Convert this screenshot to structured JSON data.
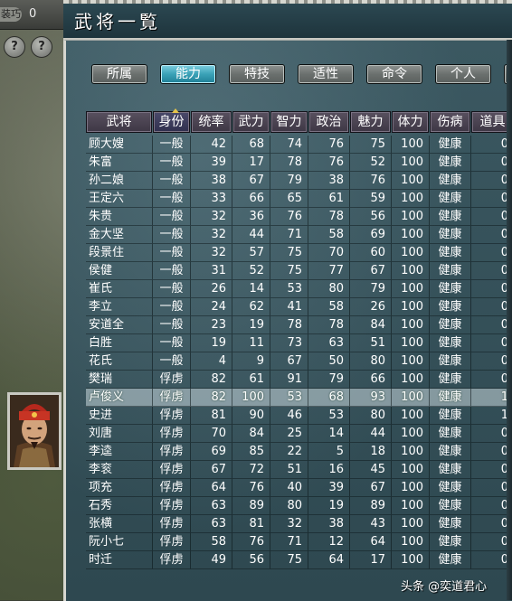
{
  "top_bar": {
    "pill": "装巧",
    "value": "0"
  },
  "side_buttons": [
    "?",
    "?"
  ],
  "window_title": "武将一覧",
  "tabs": [
    {
      "label": "所属",
      "active": false
    },
    {
      "label": "能力",
      "active": true
    },
    {
      "label": "特技",
      "active": false
    },
    {
      "label": "适性",
      "active": false
    },
    {
      "label": "命令",
      "active": false
    },
    {
      "label": "个人",
      "active": false
    }
  ],
  "columns": [
    "武将",
    "身份",
    "统率",
    "武力",
    "智力",
    "政治",
    "魅力",
    "体力",
    "伤病",
    "道具"
  ],
  "sorted_column": "身份",
  "rows": [
    [
      "顾大嫂",
      "一般",
      "42",
      "68",
      "74",
      "76",
      "75",
      "100",
      "健康",
      "0"
    ],
    [
      "朱富",
      "一般",
      "39",
      "17",
      "78",
      "76",
      "52",
      "100",
      "健康",
      "0"
    ],
    [
      "孙二娘",
      "一般",
      "38",
      "67",
      "79",
      "38",
      "76",
      "100",
      "健康",
      "0"
    ],
    [
      "王定六",
      "一般",
      "33",
      "66",
      "65",
      "61",
      "59",
      "100",
      "健康",
      "0"
    ],
    [
      "朱贵",
      "一般",
      "32",
      "36",
      "76",
      "78",
      "56",
      "100",
      "健康",
      "0"
    ],
    [
      "金大坚",
      "一般",
      "32",
      "44",
      "71",
      "58",
      "69",
      "100",
      "健康",
      "0"
    ],
    [
      "段景住",
      "一般",
      "32",
      "57",
      "75",
      "70",
      "60",
      "100",
      "健康",
      "0"
    ],
    [
      "侯健",
      "一般",
      "31",
      "52",
      "75",
      "77",
      "67",
      "100",
      "健康",
      "0"
    ],
    [
      "崔氏",
      "一般",
      "26",
      "14",
      "53",
      "80",
      "79",
      "100",
      "健康",
      "0"
    ],
    [
      "李立",
      "一般",
      "24",
      "62",
      "41",
      "58",
      "26",
      "100",
      "健康",
      "0"
    ],
    [
      "安道全",
      "一般",
      "23",
      "19",
      "78",
      "78",
      "84",
      "100",
      "健康",
      "0"
    ],
    [
      "白胜",
      "一般",
      "19",
      "11",
      "73",
      "63",
      "51",
      "100",
      "健康",
      "0"
    ],
    [
      "花氏",
      "一般",
      "4",
      "9",
      "67",
      "50",
      "80",
      "100",
      "健康",
      "0"
    ],
    [
      "樊瑞",
      "俘虏",
      "82",
      "61",
      "91",
      "79",
      "66",
      "100",
      "健康",
      "0"
    ],
    [
      "卢俊义",
      "俘虏",
      "82",
      "100",
      "53",
      "68",
      "93",
      "100",
      "健康",
      "1"
    ],
    [
      "史进",
      "俘虏",
      "81",
      "90",
      "46",
      "53",
      "80",
      "100",
      "健康",
      "1"
    ],
    [
      "刘唐",
      "俘虏",
      "70",
      "84",
      "25",
      "14",
      "44",
      "100",
      "健康",
      "0"
    ],
    [
      "李逵",
      "俘虏",
      "69",
      "85",
      "22",
      "5",
      "18",
      "100",
      "健康",
      "0"
    ],
    [
      "李衮",
      "俘虏",
      "67",
      "72",
      "51",
      "16",
      "45",
      "100",
      "健康",
      "0"
    ],
    [
      "项充",
      "俘虏",
      "64",
      "76",
      "40",
      "39",
      "67",
      "100",
      "健康",
      "0"
    ],
    [
      "石秀",
      "俘虏",
      "63",
      "89",
      "80",
      "19",
      "89",
      "100",
      "健康",
      "0"
    ],
    [
      "张横",
      "俘虏",
      "63",
      "81",
      "32",
      "38",
      "43",
      "100",
      "健康",
      "0"
    ],
    [
      "阮小七",
      "俘虏",
      "58",
      "76",
      "71",
      "12",
      "64",
      "100",
      "健康",
      "0"
    ],
    [
      "时迁",
      "俘虏",
      "49",
      "56",
      "75",
      "64",
      "17",
      "100",
      "健康",
      "0"
    ]
  ],
  "selected_row": 14,
  "watermark": "头条 @奕道君心"
}
